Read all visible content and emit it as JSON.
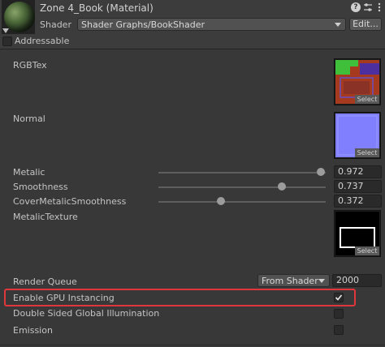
{
  "header": {
    "title": "Zone 4_Book (Material)",
    "shader_label": "Shader",
    "shader_value": "Shader Graphs/BookShader",
    "edit_button": "Edit...",
    "addressable_label": "Addressable",
    "icons": [
      "help-icon",
      "settings-sliders-icon",
      "more-options-icon"
    ]
  },
  "properties": {
    "rgbtex": {
      "label": "RGBTex",
      "select": "Select"
    },
    "normal": {
      "label": "Normal",
      "select": "Select"
    },
    "metalic": {
      "label": "Metalic",
      "value": "0.972",
      "slider_fraction": 0.972
    },
    "smoothness": {
      "label": "Smoothness",
      "value": "0.737",
      "slider_fraction": 0.737
    },
    "cover": {
      "label": "CoverMetalicSmoothness",
      "value": "0.372",
      "slider_fraction": 0.372
    },
    "metalic_texture": {
      "label": "MetalicTexture",
      "select": "Select"
    }
  },
  "advanced": {
    "render_queue_label": "Render Queue",
    "render_queue_mode": "From Shader",
    "render_queue_value": "2000",
    "gpu_instancing_label": "Enable GPU Instancing",
    "gpu_instancing_checked": true,
    "double_sided_label": "Double Sided Global Illumination",
    "emission_label": "Emission"
  },
  "colors": {
    "highlight": "#e0373c",
    "rgbtex_red": "#a53a1f",
    "rgbtex_green": "#3fbf3a",
    "normal_blue": "#8080ff"
  }
}
